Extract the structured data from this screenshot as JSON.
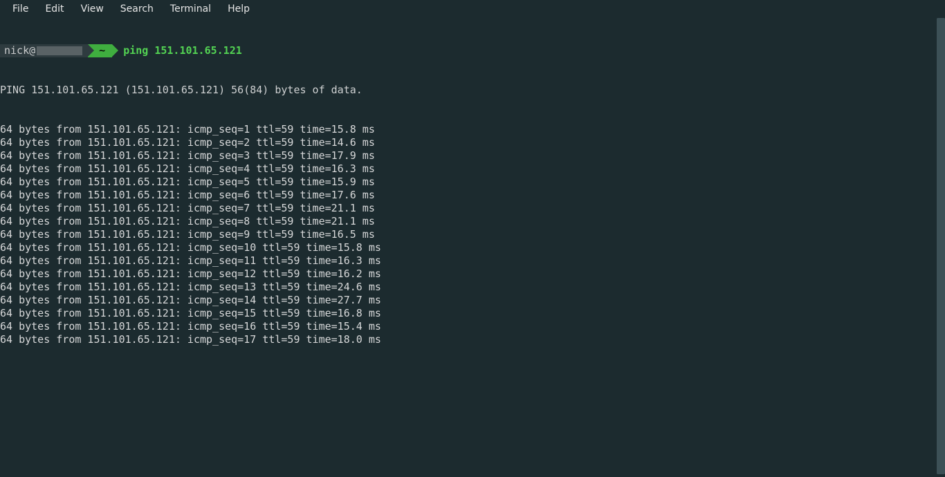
{
  "menubar": {
    "items": [
      "File",
      "Edit",
      "View",
      "Search",
      "Terminal",
      "Help"
    ]
  },
  "prompt": {
    "user": "nick@",
    "path": "~",
    "command": "ping 151.101.65.121"
  },
  "ping": {
    "first_line": "PING 151.101.65.121 (151.101.65.121) 56(84) bytes of data.",
    "target_ip": "151.101.65.121",
    "replies": [
      {
        "bytes": 64,
        "from": "151.101.65.121",
        "icmp_seq": 1,
        "ttl": 59,
        "time_ms": 15.8
      },
      {
        "bytes": 64,
        "from": "151.101.65.121",
        "icmp_seq": 2,
        "ttl": 59,
        "time_ms": 14.6
      },
      {
        "bytes": 64,
        "from": "151.101.65.121",
        "icmp_seq": 3,
        "ttl": 59,
        "time_ms": 17.9
      },
      {
        "bytes": 64,
        "from": "151.101.65.121",
        "icmp_seq": 4,
        "ttl": 59,
        "time_ms": 16.3
      },
      {
        "bytes": 64,
        "from": "151.101.65.121",
        "icmp_seq": 5,
        "ttl": 59,
        "time_ms": 15.9
      },
      {
        "bytes": 64,
        "from": "151.101.65.121",
        "icmp_seq": 6,
        "ttl": 59,
        "time_ms": 17.6
      },
      {
        "bytes": 64,
        "from": "151.101.65.121",
        "icmp_seq": 7,
        "ttl": 59,
        "time_ms": 21.1
      },
      {
        "bytes": 64,
        "from": "151.101.65.121",
        "icmp_seq": 8,
        "ttl": 59,
        "time_ms": 21.1
      },
      {
        "bytes": 64,
        "from": "151.101.65.121",
        "icmp_seq": 9,
        "ttl": 59,
        "time_ms": 16.5
      },
      {
        "bytes": 64,
        "from": "151.101.65.121",
        "icmp_seq": 10,
        "ttl": 59,
        "time_ms": 15.8
      },
      {
        "bytes": 64,
        "from": "151.101.65.121",
        "icmp_seq": 11,
        "ttl": 59,
        "time_ms": 16.3
      },
      {
        "bytes": 64,
        "from": "151.101.65.121",
        "icmp_seq": 12,
        "ttl": 59,
        "time_ms": 16.2
      },
      {
        "bytes": 64,
        "from": "151.101.65.121",
        "icmp_seq": 13,
        "ttl": 59,
        "time_ms": 24.6
      },
      {
        "bytes": 64,
        "from": "151.101.65.121",
        "icmp_seq": 14,
        "ttl": 59,
        "time_ms": 27.7
      },
      {
        "bytes": 64,
        "from": "151.101.65.121",
        "icmp_seq": 15,
        "ttl": 59,
        "time_ms": 16.8
      },
      {
        "bytes": 64,
        "from": "151.101.65.121",
        "icmp_seq": 16,
        "ttl": 59,
        "time_ms": 15.4
      },
      {
        "bytes": 64,
        "from": "151.101.65.121",
        "icmp_seq": 17,
        "ttl": 59,
        "time_ms": 18.0
      }
    ]
  }
}
